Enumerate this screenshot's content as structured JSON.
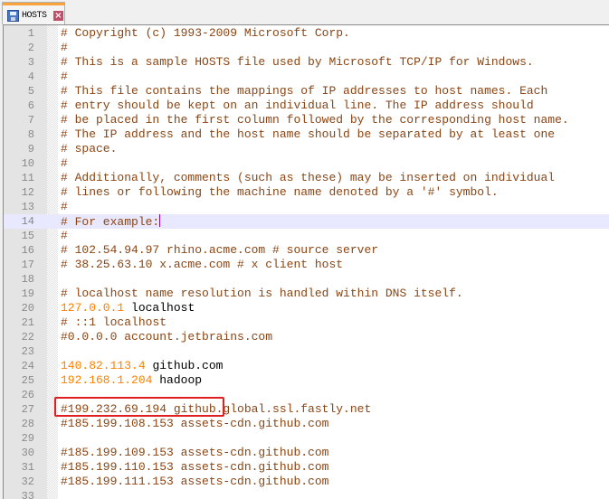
{
  "tab": {
    "label": "HOSTS",
    "icon": "save-icon",
    "close_icon": "close-icon",
    "accent": "#f9a33a"
  },
  "editor": {
    "current_line": 14,
    "highlighted_line": 25,
    "annotation_color": "#e02020",
    "lines": [
      {
        "n": "1",
        "type": "comment",
        "text": "# Copyright (c) 1993-2009 Microsoft Corp."
      },
      {
        "n": "2",
        "type": "comment",
        "text": "#"
      },
      {
        "n": "3",
        "type": "comment",
        "text": "# This is a sample HOSTS file used by Microsoft TCP/IP for Windows."
      },
      {
        "n": "4",
        "type": "comment",
        "text": "#"
      },
      {
        "n": "5",
        "type": "comment",
        "text": "# This file contains the mappings of IP addresses to host names. Each"
      },
      {
        "n": "6",
        "type": "comment",
        "text": "# entry should be kept on an individual line. The IP address should"
      },
      {
        "n": "7",
        "type": "comment",
        "text": "# be placed in the first column followed by the corresponding host name."
      },
      {
        "n": "8",
        "type": "comment",
        "text": "# The IP address and the host name should be separated by at least one"
      },
      {
        "n": "9",
        "type": "comment",
        "text": "# space."
      },
      {
        "n": "10",
        "type": "comment",
        "text": "#"
      },
      {
        "n": "11",
        "type": "comment",
        "text": "# Additionally, comments (such as these) may be inserted on individual"
      },
      {
        "n": "12",
        "type": "comment",
        "text": "# lines or following the machine name denoted by a '#' symbol."
      },
      {
        "n": "13",
        "type": "comment",
        "text": "#"
      },
      {
        "n": "14",
        "type": "comment",
        "text": "# For example:"
      },
      {
        "n": "15",
        "type": "comment",
        "text": "#"
      },
      {
        "n": "16",
        "type": "comment",
        "text": "# 102.54.94.97 rhino.acme.com # source server"
      },
      {
        "n": "17",
        "type": "comment",
        "text": "# 38.25.63.10 x.acme.com # x client host"
      },
      {
        "n": "18",
        "type": "empty",
        "text": ""
      },
      {
        "n": "19",
        "type": "comment",
        "text": "# localhost name resolution is handled within DNS itself."
      },
      {
        "n": "20",
        "type": "entry",
        "ip": "127.0.0.1",
        "host": "localhost"
      },
      {
        "n": "21",
        "type": "comment",
        "text": "# ::1 localhost"
      },
      {
        "n": "22",
        "type": "comment",
        "text": "#0.0.0.0 account.jetbrains.com"
      },
      {
        "n": "23",
        "type": "empty",
        "text": ""
      },
      {
        "n": "24",
        "type": "entry",
        "ip": "140.82.113.4",
        "host": "github.com"
      },
      {
        "n": "25",
        "type": "entry",
        "ip": "192.168.1.204",
        "host": "hadoop"
      },
      {
        "n": "26",
        "type": "empty",
        "text": ""
      },
      {
        "n": "27",
        "type": "comment",
        "text": "#199.232.69.194 github.global.ssl.fastly.net"
      },
      {
        "n": "28",
        "type": "comment",
        "text": "#185.199.108.153 assets-cdn.github.com"
      },
      {
        "n": "29",
        "type": "empty",
        "text": ""
      },
      {
        "n": "30",
        "type": "comment",
        "text": "#185.199.109.153 assets-cdn.github.com"
      },
      {
        "n": "31",
        "type": "comment",
        "text": "#185.199.110.153 assets-cdn.github.com"
      },
      {
        "n": "32",
        "type": "comment",
        "text": "#185.199.111.153 assets-cdn.github.com"
      },
      {
        "n": "33",
        "type": "empty",
        "text": ""
      }
    ]
  }
}
